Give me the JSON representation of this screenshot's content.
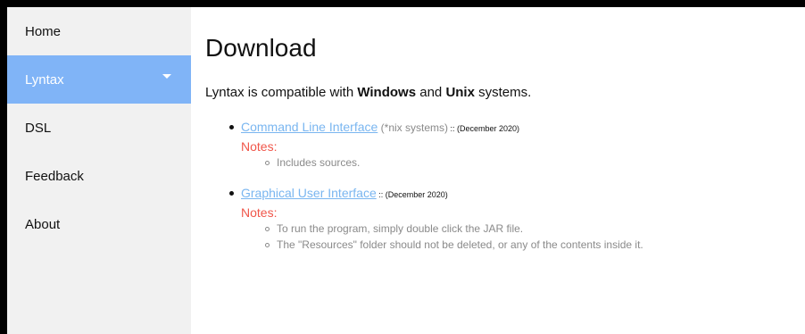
{
  "nav": {
    "items": [
      {
        "label": "Home",
        "active": false
      },
      {
        "label": "Lyntax",
        "active": true,
        "dropdown": true
      },
      {
        "label": "DSL",
        "active": false
      },
      {
        "label": "Feedback",
        "active": false
      },
      {
        "label": "About",
        "active": false
      }
    ]
  },
  "page": {
    "title": "Download",
    "intro_prefix": "Lyntax is compatible with ",
    "intro_os1": "Windows",
    "intro_and": " and ",
    "intro_os2": "Unix",
    "intro_suffix": " systems."
  },
  "downloads": [
    {
      "link": "Command Line Interface",
      "platform": " (*nix systems)",
      "date": " :: (December 2020)",
      "notes_label": "Notes:",
      "notes": [
        "Includes sources."
      ]
    },
    {
      "link": "Graphical User Interface",
      "platform": "",
      "date": " :: (December 2020)",
      "notes_label": "Notes:",
      "notes": [
        "To run the program, simply double click the JAR file.",
        "The \"Resources\" folder should not be deleted, or any of the contents inside it."
      ]
    }
  ],
  "colors": {
    "sidebar_bg": "#f1f1f1",
    "active_bg": "#80b4f7",
    "link": "#7ab6f0",
    "notes_label": "#f0564a",
    "muted": "#8a8a8a"
  }
}
